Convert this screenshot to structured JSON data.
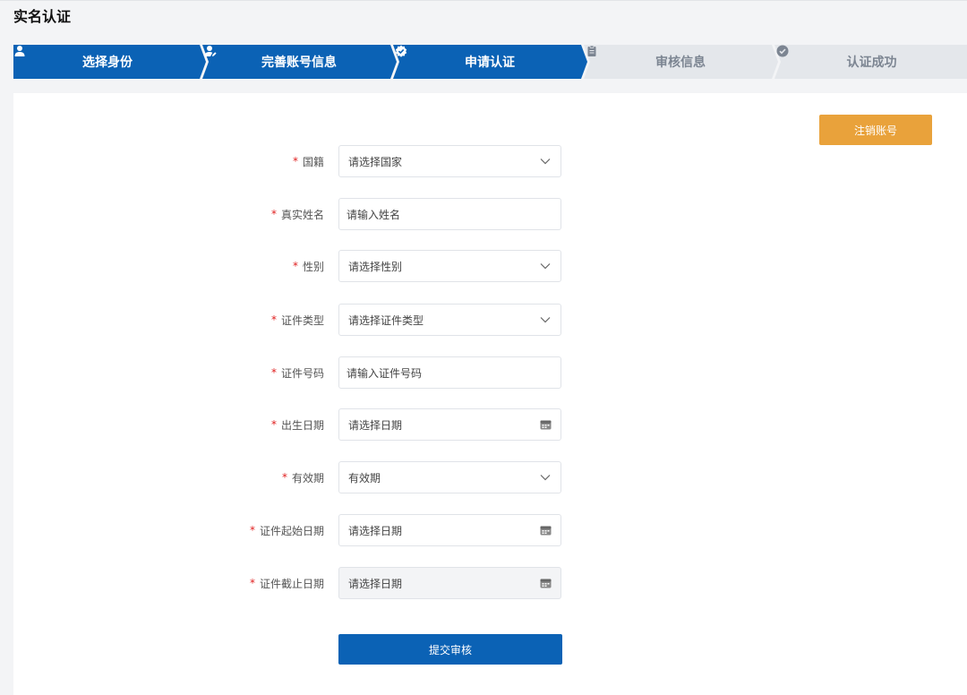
{
  "page": {
    "title": "实名认证"
  },
  "colors": {
    "primary": "#0b62b5",
    "inactive_step": "#e4e7eb",
    "warning": "#e9a23b",
    "required": "#e02020"
  },
  "steps": [
    {
      "label": "选择身份",
      "icon": "user-icon",
      "active": true
    },
    {
      "label": "完善账号信息",
      "icon": "user-edit-icon",
      "active": true
    },
    {
      "label": "申请认证",
      "icon": "badge-check-icon",
      "active": true
    },
    {
      "label": "审核信息",
      "icon": "clipboard-icon",
      "active": false
    },
    {
      "label": "认证成功",
      "icon": "check-circle-icon",
      "active": false
    }
  ],
  "actions": {
    "cancel_account": "注销账号",
    "submit": "提交审核"
  },
  "form": {
    "fields": [
      {
        "label": "国籍",
        "required": true,
        "type": "select",
        "value": "请选择国家"
      },
      {
        "label": "真实姓名",
        "required": true,
        "type": "input",
        "value": "请输入姓名"
      },
      {
        "label": "性别",
        "required": true,
        "type": "select",
        "value": "请选择性别"
      },
      {
        "label": "证件类型",
        "required": true,
        "type": "select",
        "value": "请选择证件类型"
      },
      {
        "label": "证件号码",
        "required": true,
        "type": "input",
        "value": "请输入证件号码"
      },
      {
        "label": "出生日期",
        "required": true,
        "type": "date",
        "value": "请选择日期"
      },
      {
        "label": "有效期",
        "required": true,
        "type": "select",
        "value": "有效期"
      },
      {
        "label": "证件起始日期",
        "required": true,
        "type": "date",
        "value": "请选择日期"
      },
      {
        "label": "证件截止日期",
        "required": true,
        "type": "date",
        "value": "请选择日期",
        "disabled": true
      }
    ]
  }
}
